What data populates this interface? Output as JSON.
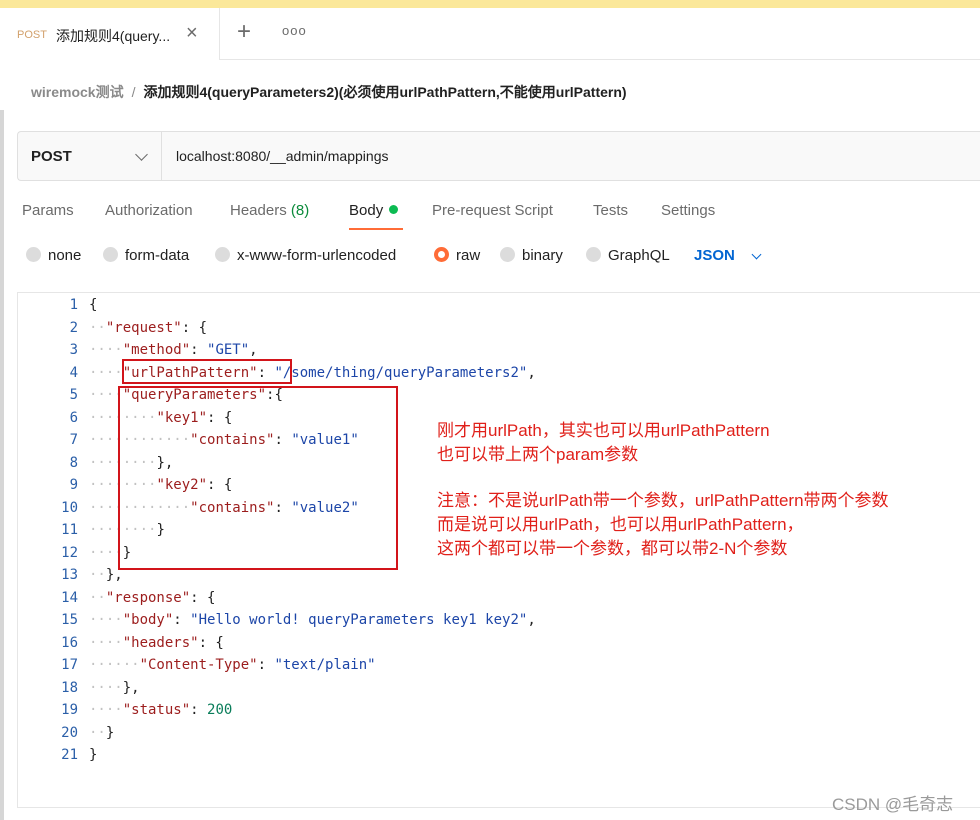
{
  "tab": {
    "method": "POST",
    "title": "添加规则4(query...",
    "close_icon": "×",
    "add_icon": "+",
    "more_icon": "ooo"
  },
  "breadcrumb": {
    "parent": "wiremock测试",
    "separator": "/",
    "current": "添加规则4(queryParameters2)(必须使用urlPathPattern,不能使用urlPattern)"
  },
  "request": {
    "method": "POST",
    "url": "localhost:8080/__admin/mappings"
  },
  "request_tabs": [
    {
      "label": "Params"
    },
    {
      "label": "Authorization"
    },
    {
      "label": "Headers",
      "count": "(8)"
    },
    {
      "label": "Body",
      "active": true
    },
    {
      "label": "Pre-request Script"
    },
    {
      "label": "Tests"
    },
    {
      "label": "Settings"
    }
  ],
  "body_types": [
    {
      "label": "none",
      "selected": false
    },
    {
      "label": "form-data",
      "selected": false
    },
    {
      "label": "x-www-form-urlencoded",
      "selected": false
    },
    {
      "label": "raw",
      "selected": true
    },
    {
      "label": "binary",
      "selected": false
    },
    {
      "label": "GraphQL",
      "selected": false
    }
  ],
  "body_format": "JSON",
  "code_lines": [
    {
      "no": "1",
      "parts": [
        [
          "p",
          "{"
        ]
      ]
    },
    {
      "no": "2",
      "indent": 1,
      "parts": [
        [
          "k",
          "\"request\""
        ],
        [
          "p",
          ": {"
        ]
      ]
    },
    {
      "no": "3",
      "indent": 2,
      "parts": [
        [
          "k",
          "\"method\""
        ],
        [
          "p",
          ": "
        ],
        [
          "s",
          "\"GET\""
        ],
        [
          "p",
          ","
        ]
      ]
    },
    {
      "no": "4",
      "indent": 2,
      "parts": [
        [
          "k",
          "\"urlPathPattern\""
        ],
        [
          "p",
          ": "
        ],
        [
          "s",
          "\"/some/thing/queryParameters2\""
        ],
        [
          "p",
          ","
        ]
      ]
    },
    {
      "no": "5",
      "indent": 2,
      "parts": [
        [
          "k",
          "\"queryParameters\""
        ],
        [
          "p",
          ":{"
        ]
      ]
    },
    {
      "no": "6",
      "indent": 4,
      "parts": [
        [
          "k",
          "\"key1\""
        ],
        [
          "p",
          ": {"
        ]
      ]
    },
    {
      "no": "7",
      "indent": 6,
      "parts": [
        [
          "k",
          "\"contains\""
        ],
        [
          "p",
          ": "
        ],
        [
          "s",
          "\"value1\""
        ]
      ]
    },
    {
      "no": "8",
      "indent": 4,
      "parts": [
        [
          "p",
          "},"
        ]
      ]
    },
    {
      "no": "9",
      "indent": 4,
      "parts": [
        [
          "k",
          "\"key2\""
        ],
        [
          "p",
          ": {"
        ]
      ]
    },
    {
      "no": "10",
      "indent": 6,
      "parts": [
        [
          "k",
          "\"contains\""
        ],
        [
          "p",
          ": "
        ],
        [
          "s",
          "\"value2\""
        ]
      ]
    },
    {
      "no": "11",
      "indent": 4,
      "parts": [
        [
          "p",
          "}"
        ]
      ]
    },
    {
      "no": "12",
      "indent": 2,
      "parts": [
        [
          "p",
          "}"
        ]
      ]
    },
    {
      "no": "13",
      "indent": 1,
      "parts": [
        [
          "p",
          "},"
        ]
      ]
    },
    {
      "no": "14",
      "indent": 1,
      "parts": [
        [
          "k",
          "\"response\""
        ],
        [
          "p",
          ": {"
        ]
      ]
    },
    {
      "no": "15",
      "indent": 2,
      "parts": [
        [
          "k",
          "\"body\""
        ],
        [
          "p",
          ": "
        ],
        [
          "s",
          "\"Hello world! queryParameters key1 key2\""
        ],
        [
          "p",
          ","
        ]
      ]
    },
    {
      "no": "16",
      "indent": 2,
      "parts": [
        [
          "k",
          "\"headers\""
        ],
        [
          "p",
          ": {"
        ]
      ]
    },
    {
      "no": "17",
      "indent": 3,
      "parts": [
        [
          "k",
          "\"Content-Type\""
        ],
        [
          "p",
          ": "
        ],
        [
          "s",
          "\"text/plain\""
        ]
      ]
    },
    {
      "no": "18",
      "indent": 2,
      "parts": [
        [
          "p",
          "},"
        ]
      ]
    },
    {
      "no": "19",
      "indent": 2,
      "parts": [
        [
          "k",
          "\"status\""
        ],
        [
          "p",
          ": "
        ],
        [
          "n",
          "200"
        ]
      ]
    },
    {
      "no": "20",
      "indent": 1,
      "parts": [
        [
          "p",
          "}"
        ]
      ]
    },
    {
      "no": "21",
      "parts": [
        [
          "p",
          "}"
        ]
      ]
    }
  ],
  "notes": [
    "刚才用urlPath，其实也可以用urlPathPattern",
    "也可以带上两个param参数",
    "注意：不是说urlPath带一个参数，urlPathPattern带两个参数",
    "而是说可以用urlPath，也可以用urlPathPattern，",
    "这两个都可以带一个参数，都可以带2-N个参数"
  ],
  "watermark": "CSDN @毛奇志",
  "colors": {
    "accent": "#ff6c37",
    "active_dot": "#0cbb52",
    "json_blue": "#0265d2",
    "annotation_red": "#e0201a"
  }
}
